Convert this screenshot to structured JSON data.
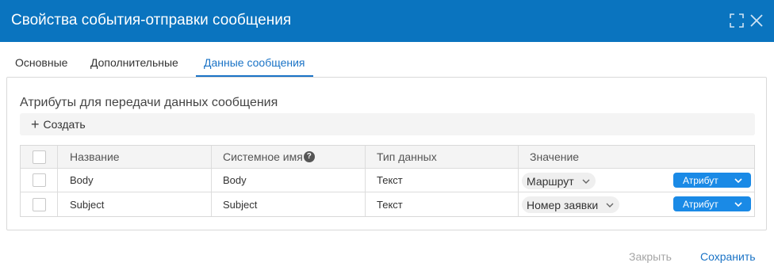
{
  "dialog": {
    "title": "Свойства события-отправки сообщения"
  },
  "tabs": [
    {
      "label": "Основные"
    },
    {
      "label": "Дополнительные"
    },
    {
      "label": "Данные сообщения",
      "active": true
    }
  ],
  "section": {
    "title": "Атрибуты для передачи данных сообщения",
    "create_label": "Создать"
  },
  "table": {
    "columns": [
      "Название",
      "Системное имя",
      "Тип данных",
      "Значение"
    ],
    "help_glyph": "?",
    "rows": [
      {
        "name": "Body",
        "system_name": "Body",
        "data_type": "Текст",
        "value": "Маршрут",
        "value_source": "Атрибут"
      },
      {
        "name": "Subject",
        "system_name": "Subject",
        "data_type": "Текст",
        "value": "Номер заявки",
        "value_source": "Атрибут"
      }
    ]
  },
  "footer": {
    "close_label": "Закрыть",
    "save_label": "Сохранить"
  },
  "colors": {
    "titlebar": "#0a74bf",
    "accent": "#1a73c6",
    "attribute_button": "#1a8ae6",
    "disabled_text": "#a6a6a6"
  },
  "icons": [
    "maximize-icon",
    "close-icon",
    "plus-icon",
    "help-icon",
    "chevron-down-icon"
  ]
}
